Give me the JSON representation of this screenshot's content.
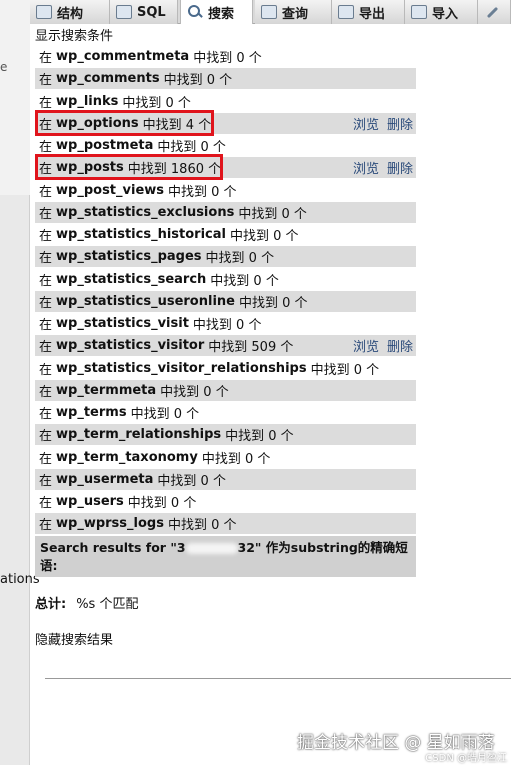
{
  "tabs": [
    {
      "label": "结构",
      "icon": "structure-icon"
    },
    {
      "label": "SQL",
      "icon": "sql-icon"
    },
    {
      "label": "搜索",
      "icon": "search-icon",
      "active": true
    },
    {
      "label": "查询",
      "icon": "query-icon"
    },
    {
      "label": "导出",
      "icon": "export-icon"
    },
    {
      "label": "导入",
      "icon": "import-icon"
    },
    {
      "label": "",
      "icon": "wrench-icon"
    }
  ],
  "sidebar": {
    "mark": "e",
    "cut_text": "ations"
  },
  "heading": "显示搜索条件",
  "row_prefix": "在",
  "actions": {
    "browse": "浏览",
    "delete": "删除"
  },
  "results": [
    {
      "table": "wp_commentmeta",
      "result": "中找到 0 个"
    },
    {
      "table": "wp_comments",
      "result": "中找到 0 个"
    },
    {
      "table": "wp_links",
      "result": "中找到 0 个"
    },
    {
      "table": "wp_options",
      "result": "中找到 4 个"
    },
    {
      "table": "wp_postmeta",
      "result": "中找到 0 个"
    },
    {
      "table": "wp_posts",
      "result": "中找到 1860 个"
    },
    {
      "table": "wp_post_views",
      "result": "中找到 0 个"
    },
    {
      "table": "wp_statistics_exclusions",
      "result": "中找到 0 个"
    },
    {
      "table": "wp_statistics_historical",
      "result": "中找到 0 个"
    },
    {
      "table": "wp_statistics_pages",
      "result": "中找到 0 个"
    },
    {
      "table": "wp_statistics_search",
      "result": "中找到 0 个"
    },
    {
      "table": "wp_statistics_useronline",
      "result": "中找到 0 个"
    },
    {
      "table": "wp_statistics_visit",
      "result": "中找到 0 个"
    },
    {
      "table": "wp_statistics_visitor",
      "result": "中找到 509 个"
    },
    {
      "table": "wp_statistics_visitor_relationships",
      "result": "中找到 0 个"
    },
    {
      "table": "wp_termmeta",
      "result": "中找到 0 个"
    },
    {
      "table": "wp_terms",
      "result": "中找到 0 个"
    },
    {
      "table": "wp_term_relationships",
      "result": "中找到 0 个"
    },
    {
      "table": "wp_term_taxonomy",
      "result": "中找到 0 个"
    },
    {
      "table": "wp_usermeta",
      "result": "中找到 0 个"
    },
    {
      "table": "wp_users",
      "result": "中找到 0 个"
    },
    {
      "table": "wp_wprss_logs",
      "result": "中找到 0 个"
    }
  ],
  "summary": {
    "prefix": "Search results for \"3",
    "suffix": "32\" 作为substring的精确短语:"
  },
  "total": {
    "label": "总计:",
    "value": "%s 个匹配"
  },
  "hide_results": "隐藏搜索结果",
  "watermark": "掘金技术社区 @ 星如雨落",
  "watermark_small": "CSDN @皓月盈江",
  "colors": {
    "highlight": "#e0141c",
    "row_shade": "#dcdcdc",
    "summary_bg": "#d0d0d0"
  }
}
